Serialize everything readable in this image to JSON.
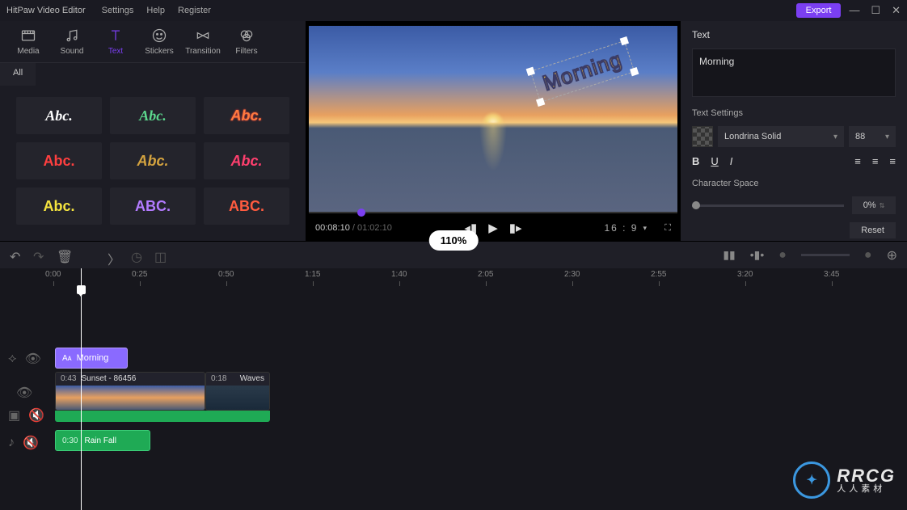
{
  "app": {
    "name": "HitPaw Video Editor"
  },
  "menu": {
    "settings": "Settings",
    "help": "Help",
    "register": "Register"
  },
  "export_label": "Export",
  "tool_tabs": {
    "media": "Media",
    "sound": "Sound",
    "text": "Text",
    "stickers": "Stickers",
    "transition": "Transition",
    "filters": "Filters"
  },
  "subtab_all": "All",
  "styles": [
    "Abc.",
    "Abc.",
    "Abc.",
    "Abc.",
    "Abc.",
    "Abc.",
    "Abc.",
    "ABC.",
    "ABC."
  ],
  "preview": {
    "overlay_text": "Morning",
    "current_time": "00:08:10",
    "total_time": "01:02:10",
    "aspect": "16 : 9"
  },
  "text_panel": {
    "title": "Text",
    "value": "Morning",
    "settings_label": "Text Settings",
    "font": "Londrina Solid",
    "font_size": "88",
    "char_space_label": "Character Space",
    "char_space_value": "0%",
    "reset": "Reset"
  },
  "zoom": "110%",
  "ruler_ticks": [
    "0:00",
    "0:25",
    "0:50",
    "1:15",
    "1:40",
    "2:05",
    "2:30",
    "2:55",
    "3:20",
    "3:45"
  ],
  "clips": {
    "text_clip": "Morning",
    "video1_dur": "0:43",
    "video1_name": "Sunset - 86456",
    "video2_dur": "0:18",
    "video2_name": "Waves",
    "audio_dur": "0:30",
    "audio_name": "Rain Fall"
  },
  "watermark": {
    "big": "RRCG",
    "small": "人人素材"
  }
}
